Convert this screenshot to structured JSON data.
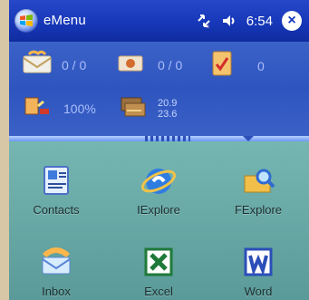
{
  "window": {
    "title": "eMenu",
    "time": "6:54"
  },
  "status_panel": {
    "messages": "0 / 0",
    "sms": "0 / 0",
    "tasks": "0",
    "battery": "100%",
    "memory_line1": "20.9",
    "memory_line2": "23.6"
  },
  "apps": [
    {
      "label": "Contacts",
      "icon": "contacts-icon"
    },
    {
      "label": "IExplore",
      "icon": "internet-explorer-icon"
    },
    {
      "label": "FExplore",
      "icon": "file-explorer-icon"
    },
    {
      "label": "Inbox",
      "icon": "inbox-icon"
    },
    {
      "label": "Excel",
      "icon": "excel-icon"
    },
    {
      "label": "Word",
      "icon": "word-icon"
    }
  ]
}
